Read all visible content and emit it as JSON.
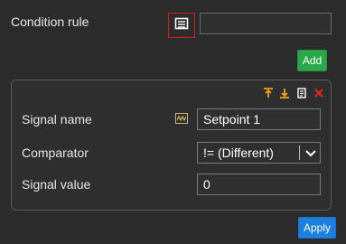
{
  "condition_rule": {
    "label": "Condition rule",
    "input_value": ""
  },
  "actions": {
    "add_label": "Add",
    "apply_label": "Apply"
  },
  "condition_panel": {
    "toolbar_icons": [
      "move-up-icon",
      "move-down-icon",
      "copy-icon",
      "delete-icon"
    ],
    "signal_name": {
      "label": "Signal name",
      "value": "Setpoint 1"
    },
    "comparator": {
      "label": "Comparator",
      "selected": "!= (Different)"
    },
    "signal_value": {
      "label": "Signal value",
      "value": "0"
    }
  },
  "colors": {
    "background": "#2b2b2b",
    "panel_border": "#5a5a5a",
    "add_green": "#2aa84a",
    "apply_blue": "#1c7fe0",
    "focus_red": "#d11f1f",
    "toolbar_orange": "#f0a21a",
    "delete_red": "#e02424"
  }
}
